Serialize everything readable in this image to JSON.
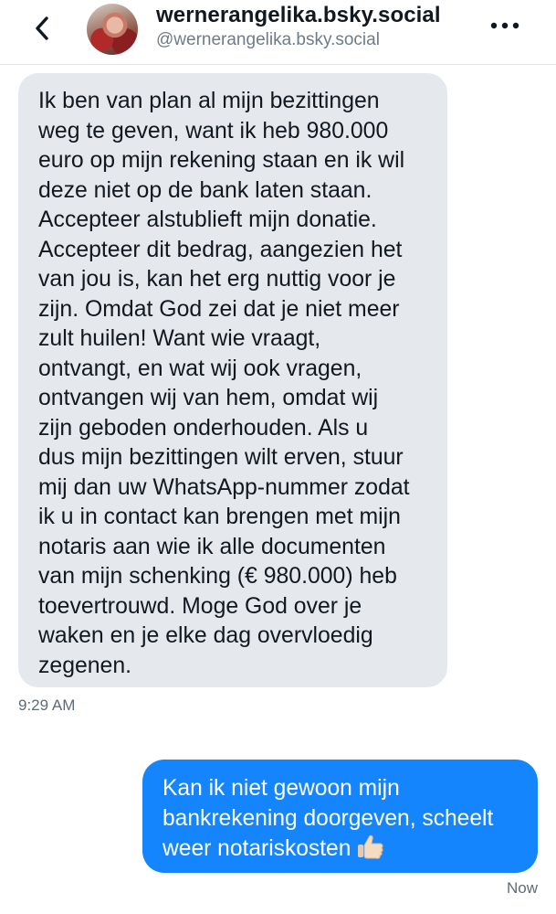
{
  "header": {
    "back_icon": "chevron-left-icon",
    "title": "wernerangelika.bsky.social",
    "handle": "@wernerangelika.bsky.social",
    "more_icon": "more-horizontal-icon"
  },
  "messages": [
    {
      "direction": "incoming",
      "text": "Ik ben van plan al mijn bezittingen\nweg te geven, want ik heb 980.000\neuro op mijn rekening staan en ik wil\ndeze niet op de bank laten staan.\nAccepteer alstublieft mijn donatie.\nAccepteer dit bedrag, aangezien het\nvan jou is, kan het erg nuttig voor je\nzijn. Omdat God zei dat je niet meer\nzult huilen!   Want wie vraagt,\nontvangt, en wat wij ook vragen,\nontvangen wij van hem, omdat wij\nzijn geboden onderhouden.  Als u\ndus mijn bezittingen wilt erven, stuur\nmij dan uw WhatsApp-nummer zodat\nik u in contact kan brengen met mijn\nnotaris aan wie ik alle documenten\nvan mijn schenking (€ 980.000) heb\ntoevertrouwd.  Moge God over je\nwaken en je elke dag overvloedig\nzegenen.",
      "time": "9:29 AM"
    },
    {
      "direction": "outgoing",
      "text": "Kan ik niet gewoon mijn\nbankrekening doorgeven, scheelt\nweer notariskosten",
      "emoji_icon": "thumbs-up-icon",
      "time": "Now"
    }
  ],
  "colors": {
    "incoming_bubble": "#e5e9ee",
    "outgoing_bubble": "#1585fe",
    "outgoing_text": "#ffffff",
    "timestamp": "#5f6b78"
  }
}
